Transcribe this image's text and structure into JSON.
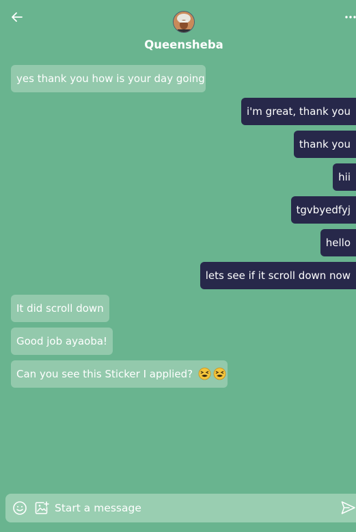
{
  "header": {
    "contact_name": "Queensheba"
  },
  "messages": [
    {
      "direction": "incoming",
      "text": "yes thank you how is your day going"
    },
    {
      "direction": "outgoing",
      "text": "i'm great, thank you"
    },
    {
      "direction": "outgoing",
      "text": "thank you"
    },
    {
      "direction": "outgoing",
      "text": "hii"
    },
    {
      "direction": "outgoing",
      "text": "tgvbyedfyj"
    },
    {
      "direction": "outgoing",
      "text": "hello"
    },
    {
      "direction": "outgoing",
      "text": "lets see if it scroll down now"
    },
    {
      "direction": "incoming",
      "text": "It did scroll down"
    },
    {
      "direction": "incoming",
      "text": "Good job ayaoba!"
    },
    {
      "direction": "incoming",
      "text": "Can you see this Sticker I applied?",
      "stickers": [
        "tired-face-emoji",
        "tired-face-emoji"
      ]
    }
  ],
  "composer": {
    "placeholder": "Start a message",
    "value": ""
  },
  "colors": {
    "background": "#69b48f",
    "incoming_bubble": "#93c9ac",
    "outgoing_bubble": "#27284a",
    "composer": "#99ceb1",
    "text": "#ffffff"
  },
  "icons": {
    "back": "arrow-left-icon",
    "more": "more-horizontal-icon",
    "emoji": "smiley-icon",
    "image": "image-add-icon",
    "send": "send-icon"
  }
}
